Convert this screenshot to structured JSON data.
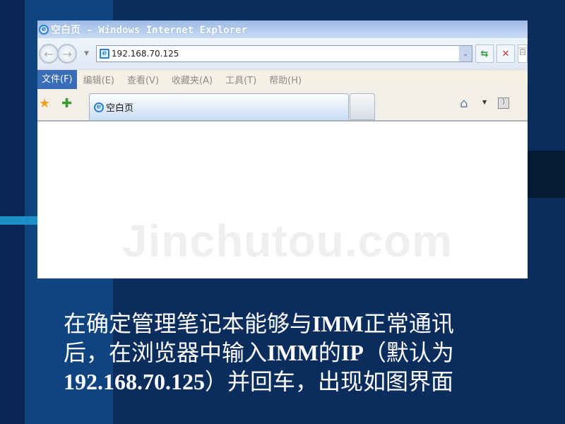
{
  "browser": {
    "title": "空白页 - Windows Internet Explorer",
    "address": "192.168.70.125",
    "search_partial": "百",
    "menu": [
      "文件(F)",
      "编辑(E)",
      "查看(V)",
      "收藏夹(A)",
      "工具(T)",
      "帮助(H)"
    ],
    "tab_title": "空白页",
    "icons": [
      "back-icon",
      "forward-icon",
      "ie-icon",
      "refresh-icon",
      "stop-icon",
      "favorites-star-icon",
      "add-favorites-icon",
      "home-icon",
      "rss-icon"
    ]
  },
  "watermark": "Jinchutou.com",
  "caption": {
    "l1a": "在确定管理笔记本能够与",
    "l1b": "IMM",
    "l1c": "正常通讯",
    "l2a": "后，在浏览器中输入",
    "l2b": "IMM",
    "l2c": "的",
    "l2d": "IP",
    "l2e": "（默认为",
    "l3a": "192.168.70.125",
    "l3b": "）并回车，出现如图界面"
  },
  "colors": {
    "background": "#0b2d5e",
    "menu_active": "#3a6db8"
  }
}
